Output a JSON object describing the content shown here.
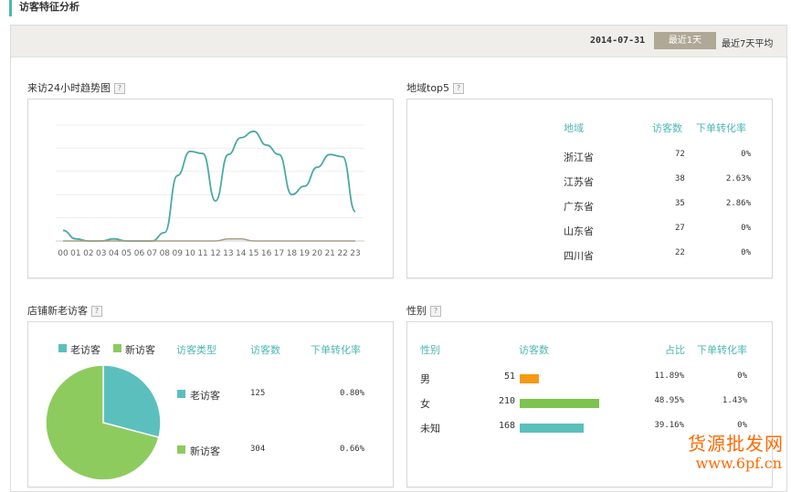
{
  "page_title": "访客特征分析",
  "toolbar": {
    "date": "2014-07-31",
    "btn_last1": "最近1天",
    "btn_last7": "最近7天平均"
  },
  "help_mark": "?",
  "hourly": {
    "title": "来访24小时趋势图",
    "chart_data": {
      "type": "line",
      "categories": [
        "00",
        "01",
        "02",
        "03",
        "04",
        "05",
        "06",
        "07",
        "08",
        "09",
        "10",
        "11",
        "12",
        "13",
        "14",
        "15",
        "16",
        "17",
        "18",
        "19",
        "20",
        "21",
        "22",
        "23"
      ],
      "series": [
        {
          "values": [
            10,
            2,
            0,
            0,
            2,
            0,
            0,
            0,
            8,
            62,
            85,
            83,
            38,
            82,
            98,
            104,
            91,
            82,
            44,
            52,
            70,
            82,
            80,
            28
          ]
        },
        {
          "values": [
            0,
            0,
            0,
            0,
            0,
            0,
            0,
            0,
            0,
            0,
            0,
            0,
            0,
            2,
            2,
            0,
            0,
            0,
            0,
            0,
            0,
            0,
            0,
            0
          ]
        }
      ],
      "ylim": [
        0,
        110
      ],
      "grid": true,
      "colors": [
        "#4aa9a6",
        "#a89e86"
      ]
    }
  },
  "region": {
    "title": "地域top5",
    "headers": {
      "region": "地域",
      "visitors": "访客数",
      "conv": "下单转化率"
    },
    "rows": [
      {
        "name": "浙江省",
        "visitors": "72",
        "conv": "0%"
      },
      {
        "name": "江苏省",
        "visitors": "38",
        "conv": "2.63%"
      },
      {
        "name": "广东省",
        "visitors": "35",
        "conv": "2.86%"
      },
      {
        "name": "山东省",
        "visitors": "27",
        "conv": "0%"
      },
      {
        "name": "四川省",
        "visitors": "22",
        "conv": "0%"
      }
    ],
    "bubbles": {
      "zj": "浙江省",
      "js": "江苏省",
      "gd": "广东省",
      "sd": "山东省",
      "sc": "四川省"
    },
    "colors": {
      "zj": "#f59a12",
      "js": "#7dc34f",
      "gd": "#4cb7b3",
      "sd": "#5cc6c3",
      "sc": "#7fd0ce"
    }
  },
  "newold": {
    "title": "店铺新老访客",
    "legend": {
      "old": "老访客",
      "new": "新访客"
    },
    "headers": {
      "type": "访客类型",
      "visitors": "访客数",
      "conv": "下单转化率"
    },
    "rows": [
      {
        "type": "老访客",
        "visitors": "125",
        "conv": "0.80%"
      },
      {
        "type": "新访客",
        "visitors": "304",
        "conv": "0.66%"
      }
    ],
    "chart_data": {
      "type": "pie",
      "labels": [
        "老访客",
        "新访客"
      ],
      "values": [
        125,
        304
      ],
      "colors": [
        "#5bc0bd",
        "#8dcb5f"
      ]
    }
  },
  "gender": {
    "title": "性别",
    "headers": {
      "gender": "性别",
      "visitors": "访客数",
      "share": "占比",
      "conv": "下单转化率"
    },
    "rows": [
      {
        "label": "男",
        "visitors": "51",
        "share": "11.89%",
        "conv": "0%",
        "bar": 0.243,
        "color": "#f59a12"
      },
      {
        "label": "女",
        "visitors": "210",
        "share": "48.95%",
        "conv": "1.43%",
        "bar": 1.0,
        "color": "#7dc34f"
      },
      {
        "label": "未知",
        "visitors": "168",
        "share": "39.16%",
        "conv": "0%",
        "bar": 0.8,
        "color": "#5bc0bd"
      }
    ]
  },
  "watermark": {
    "line1": "货源批发网",
    "line2": "www.6pf.cn"
  }
}
